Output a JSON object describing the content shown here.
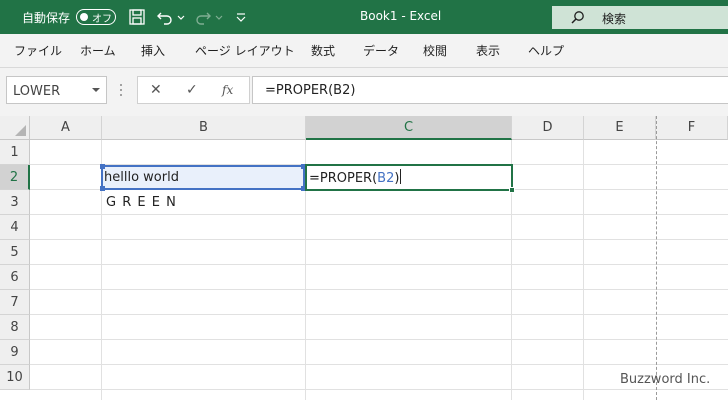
{
  "titlebar": {
    "autosave_label": "自動保存",
    "autosave_state": "オフ",
    "title": "Book1  -  Excel",
    "search_label": "検索"
  },
  "ribbon": {
    "tabs": [
      "ファイル",
      "ホーム",
      "挿入",
      "ページ レイアウト",
      "数式",
      "データ",
      "校閲",
      "表示",
      "ヘルプ"
    ]
  },
  "formula_bar": {
    "name_box": "LOWER",
    "cancel": "✕",
    "enter": "✓",
    "fx": "fx",
    "formula": "=PROPER(B2)"
  },
  "grid": {
    "columns": [
      "A",
      "B",
      "C",
      "D",
      "E",
      "F"
    ],
    "rows": [
      "1",
      "2",
      "3",
      "4",
      "5",
      "6",
      "7",
      "8",
      "9",
      "10"
    ],
    "cells": {
      "B2": "helllo world",
      "B3": "G R E E N",
      "C2_prefix": "=PROPER(",
      "C2_ref": "B2",
      "C2_suffix": ")"
    }
  },
  "watermark": "Buzzword Inc.",
  "colors": {
    "accent": "#217346",
    "reference": "#4472c4"
  }
}
